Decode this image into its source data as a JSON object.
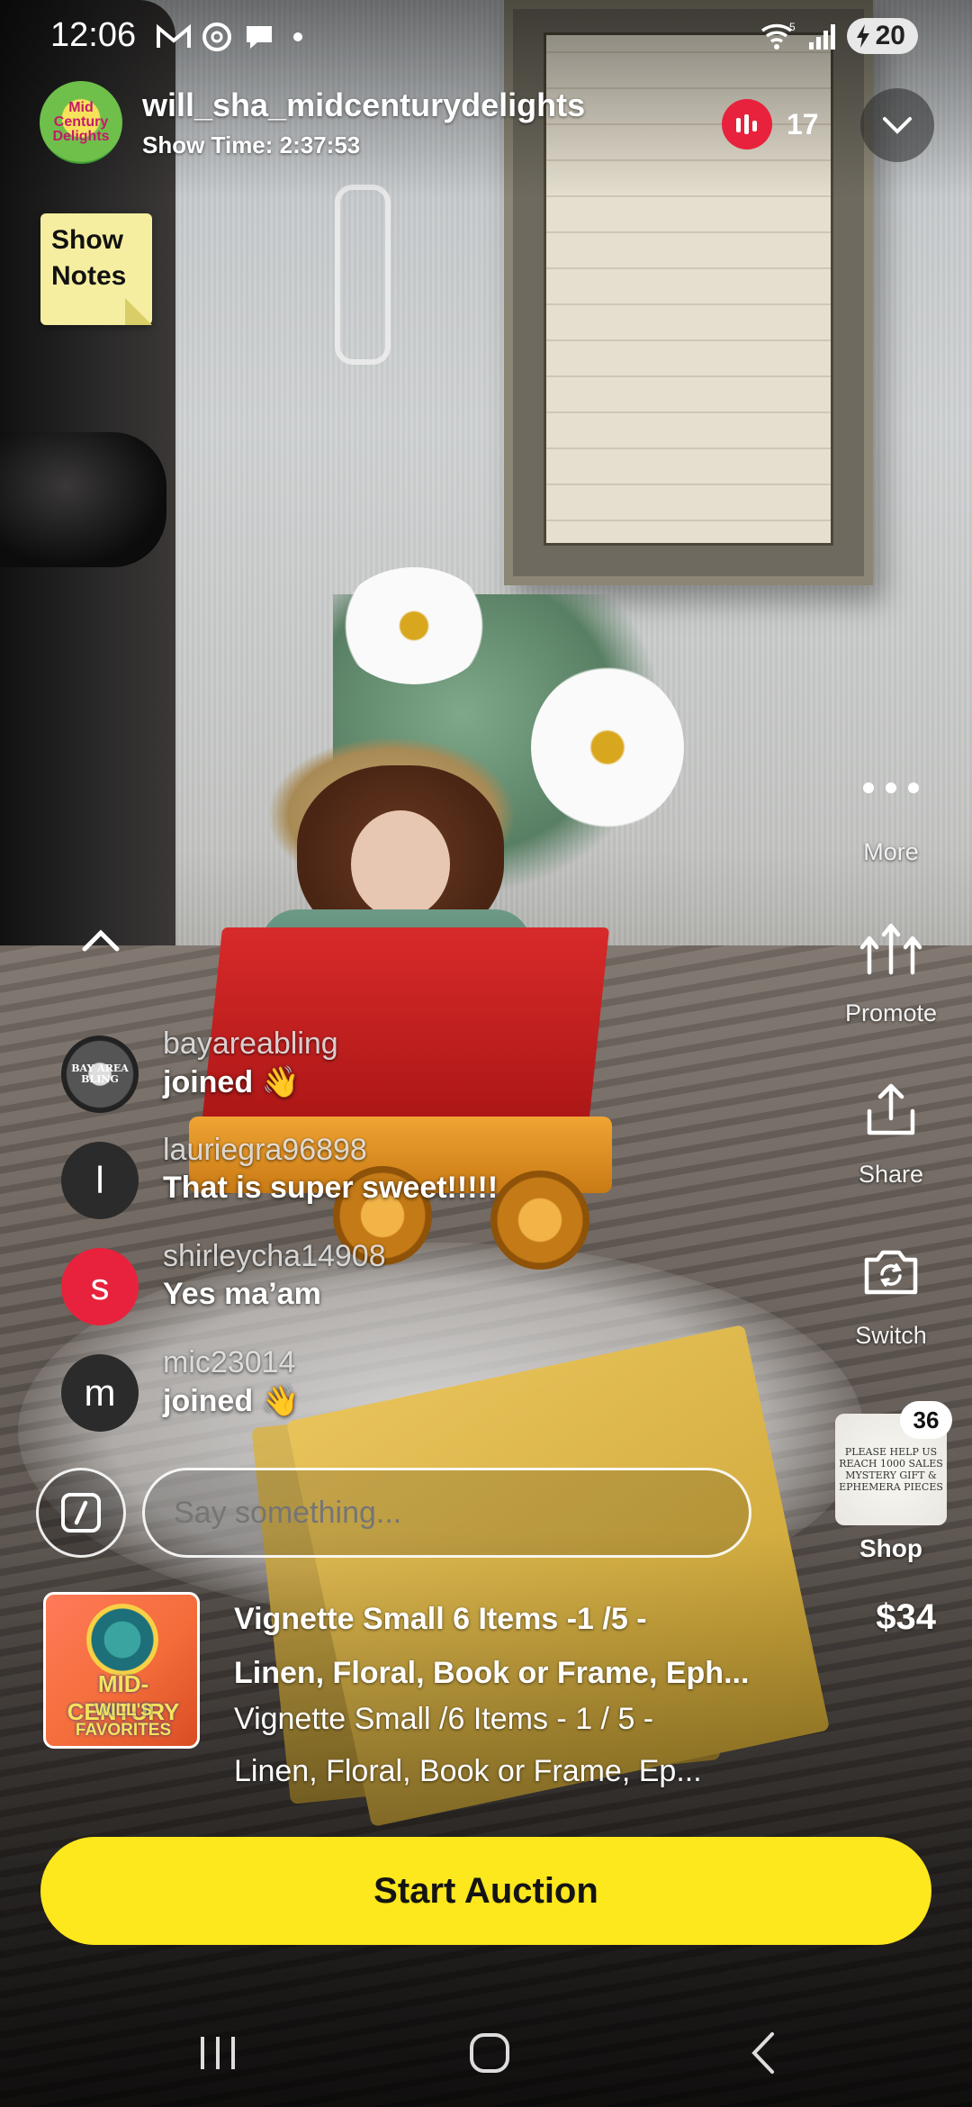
{
  "status_bar": {
    "time": "12:06",
    "wifi_label": "5",
    "battery": "20",
    "icons": [
      "gmail-icon",
      "threads-icon",
      "chat-bubble-icon",
      "dot-icon",
      "wifi-icon",
      "signal-icon",
      "battery-charging-icon"
    ]
  },
  "host": {
    "avatar_text": "Mid Century Delights",
    "name": "will_sha_midcenturydelights",
    "show_time": "Show Time: 2:37:53",
    "viewer_count": "17"
  },
  "show_notes": {
    "line1": "Show",
    "line2": "Notes"
  },
  "chat": {
    "messages": [
      {
        "user": "bayareabling",
        "message": "joined 👋",
        "avatar_letter": "",
        "avatar_color": "#2b2b2b",
        "avatar_text": "BAY AREA BLING"
      },
      {
        "user": "lauriegra96898",
        "message": "That is super sweet!!!!!",
        "avatar_letter": "l",
        "avatar_color": "#2b2b2b"
      },
      {
        "user": "shirleycha14908",
        "message": "Yes ma’am",
        "avatar_letter": "s",
        "avatar_color": "#e8223c"
      },
      {
        "user": "mic23014",
        "message": "joined 👋",
        "avatar_letter": "m",
        "avatar_color": "#2b2b2b"
      }
    ]
  },
  "side_actions": {
    "more": "More",
    "promote": "Promote",
    "share": "Share",
    "switch": "Switch"
  },
  "shop": {
    "count": "36",
    "label": "Shop",
    "card_text": "PLEASE HELP US REACH 1000 SALES MYSTERY GIFT & EPHEMERA PIECES"
  },
  "compose": {
    "placeholder": "Say something..."
  },
  "product": {
    "thumb_text1": "MID-CENTURY",
    "thumb_text2": "WILL'S FAVORITES",
    "title_line1": "Vignette Small 6 Items -1 /5 -",
    "title_line2": "Linen, Floral, Book or Frame, Eph...",
    "desc_line1": "Vignette Small /6 Items - 1 / 5 -",
    "desc_line2": "Linen, Floral, Book or Frame, Ep...",
    "price": "$34"
  },
  "cta": {
    "start_auction": "Start Auction"
  },
  "colors": {
    "accent_yellow": "#fde71d",
    "live_red": "#e8223c",
    "notes_yellow": "#f5eea0"
  }
}
